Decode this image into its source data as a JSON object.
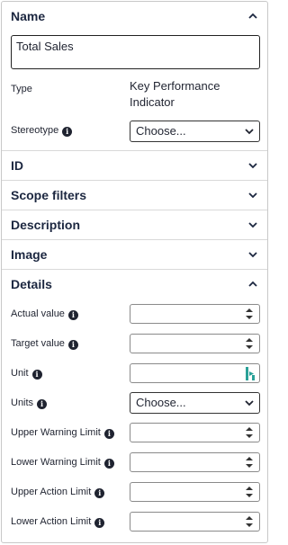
{
  "sections": {
    "name": "Name",
    "id": "ID",
    "scope_filters": "Scope filters",
    "description": "Description",
    "image": "Image",
    "details": "Details"
  },
  "name_field": {
    "value": "Total Sales"
  },
  "type": {
    "label": "Type",
    "value": "Key Performance Indicator"
  },
  "stereotype": {
    "label": "Stereotype",
    "selected": "Choose..."
  },
  "details": {
    "actual_value": {
      "label": "Actual value",
      "value": ""
    },
    "target_value": {
      "label": "Target value",
      "value": ""
    },
    "unit": {
      "label": "Unit",
      "value": ""
    },
    "units": {
      "label": "Units",
      "selected": "Choose..."
    },
    "upper_warning_limit": {
      "label": "Upper Warning Limit",
      "value": ""
    },
    "lower_warning_limit": {
      "label": "Lower Warning Limit",
      "value": ""
    },
    "upper_action_limit": {
      "label": "Upper Action Limit",
      "value": ""
    },
    "lower_action_limit": {
      "label": "Lower Action Limit",
      "value": ""
    }
  },
  "icons": {
    "info": "info-icon",
    "expand": "chevron-down-icon",
    "collapse": "chevron-up-icon",
    "spinner": "spinner-icon",
    "unit_picker": "unit-picker-icon"
  },
  "colors": {
    "heading": "#1c2740",
    "border": "#c8c8c8",
    "unit_icon": "#2aa198"
  }
}
